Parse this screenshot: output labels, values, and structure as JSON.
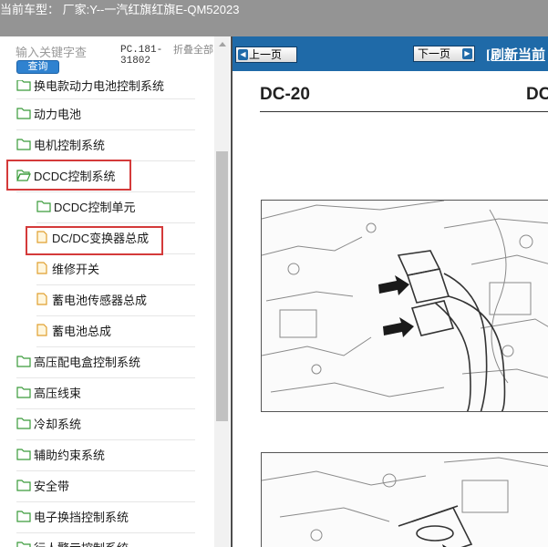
{
  "header": {
    "text": "当前车型： 厂家:Y--一汽红旗红旗E-QM52023"
  },
  "search": {
    "placeholder": "输入关键字查",
    "button_label": "查询",
    "pc_code": "PC.181-31802",
    "fold_all_label": "折叠全部"
  },
  "tree": {
    "items": [
      {
        "label": "换电款动力电池控制系统",
        "type": "folder"
      },
      {
        "label": "动力电池",
        "type": "folder"
      },
      {
        "label": "电机控制系统",
        "type": "folder"
      },
      {
        "label": "DCDC控制系统",
        "type": "folder-open"
      },
      {
        "label": "DCDC控制单元",
        "type": "folder"
      },
      {
        "label": "DC/DC变换器总成",
        "type": "page"
      },
      {
        "label": "维修开关",
        "type": "page"
      },
      {
        "label": "蓄电池传感器总成",
        "type": "page"
      },
      {
        "label": "蓄电池总成",
        "type": "page"
      },
      {
        "label": "高压配电盒控制系统",
        "type": "folder"
      },
      {
        "label": "高压线束",
        "type": "folder"
      },
      {
        "label": "冷却系统",
        "type": "folder"
      },
      {
        "label": "辅助约束系统",
        "type": "folder"
      },
      {
        "label": "安全带",
        "type": "folder"
      },
      {
        "label": "电子换挡控制系统",
        "type": "folder"
      },
      {
        "label": "行人警示控制系统",
        "type": "folder"
      }
    ]
  },
  "nav": {
    "prev_label": "上一页",
    "next_label": "下一页",
    "refresh_label": "[刷新当前"
  },
  "doc": {
    "code_left": "DC-20",
    "code_right": "DC"
  },
  "colors": {
    "header_bg": "#949494",
    "nav_bg": "#1f6aa8",
    "highlight_border": "#d43a3a",
    "folder_green": "#3a9b3a",
    "page_orange": "#e0a030"
  }
}
